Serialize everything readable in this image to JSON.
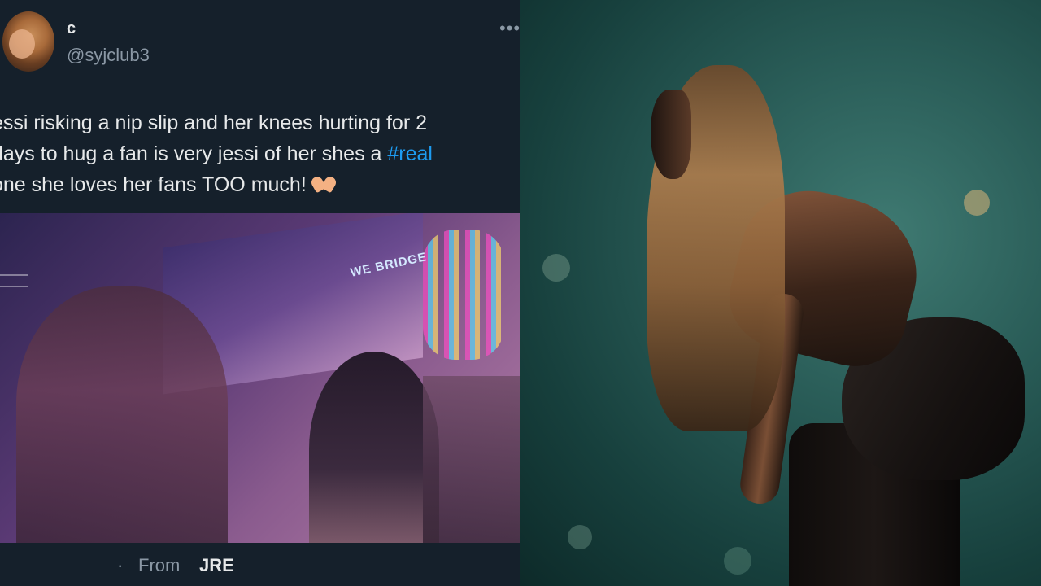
{
  "tweet": {
    "display_name": "c",
    "handle": "@syjclub3",
    "more_icon": "•••",
    "text_lines": [
      "essi risking a nip slip and her knees hurting for 2",
      "days to hug a fan is very jessi of her shes a",
      "one she loves her fans TOO much!"
    ],
    "hashtag": "#real",
    "media": {
      "screen_text": "WE BRIDGE"
    },
    "footer": {
      "dot": "·",
      "from_label": "From",
      "source": "JRE"
    }
  },
  "colors": {
    "background": "#15202b",
    "text_primary": "#e7e9ea",
    "text_secondary": "#8b98a5",
    "hashtag": "#1d9bf0",
    "photo_background": "#2a5d58"
  },
  "icons": [
    "avatar",
    "more-icon",
    "heart-hands-icon"
  ]
}
